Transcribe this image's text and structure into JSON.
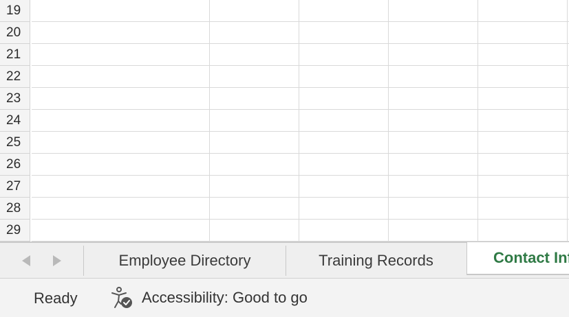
{
  "grid": {
    "rows": [
      "19",
      "20",
      "21",
      "22",
      "23",
      "24",
      "25",
      "26",
      "27",
      "28",
      "29"
    ]
  },
  "sheet_tabs": {
    "items": [
      {
        "label": "Employee Directory"
      },
      {
        "label": "Training Records"
      },
      {
        "label": "Contact Information"
      }
    ],
    "active_index": 2
  },
  "status": {
    "ready_label": "Ready",
    "accessibility_label": "Accessibility: Good to go"
  },
  "colors": {
    "active_tab_text": "#2f7a45",
    "icon_gray": "#555555"
  }
}
